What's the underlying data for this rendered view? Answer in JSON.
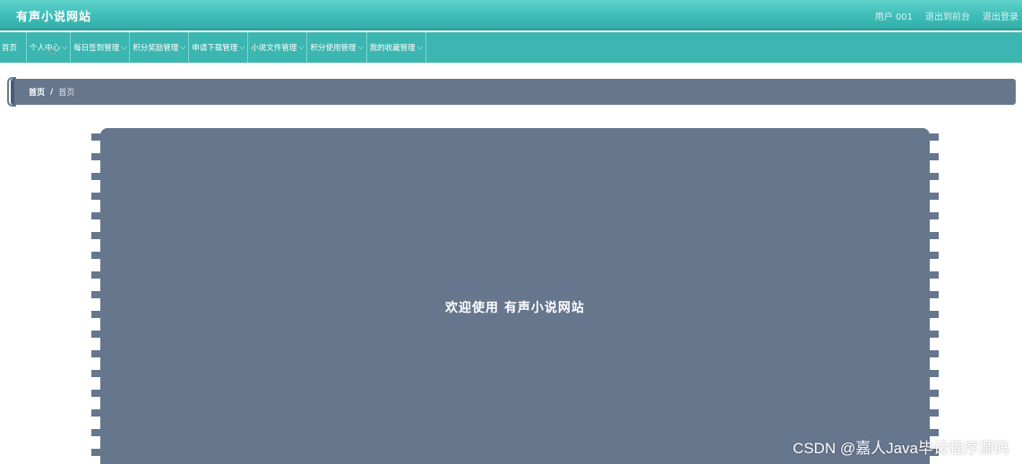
{
  "header": {
    "title": "有声小说网站",
    "user_label": "用户 001",
    "back_to_front": "退出到前台",
    "logout": "退出登录"
  },
  "nav": {
    "items": [
      {
        "label": "首页",
        "has_caret": false
      },
      {
        "label": "个人中心",
        "has_caret": true
      },
      {
        "label": "每日签到管理",
        "has_caret": true
      },
      {
        "label": "积分奖励管理",
        "has_caret": true
      },
      {
        "label": "申请下载管理",
        "has_caret": true
      },
      {
        "label": "小说文件管理",
        "has_caret": true
      },
      {
        "label": "积分使用管理",
        "has_caret": true
      },
      {
        "label": "我的收藏管理",
        "has_caret": true
      }
    ],
    "caret_glyph": "⌵"
  },
  "breadcrumb": {
    "home": "首页",
    "separator": "/",
    "current": "首页"
  },
  "main": {
    "welcome": "欢迎使用 有声小说网站"
  },
  "watermark": "CSDN @嘉人Java毕设程序源码",
  "colors": {
    "teal_header": "#3fbdb8",
    "slate_panel": "#66768d"
  }
}
